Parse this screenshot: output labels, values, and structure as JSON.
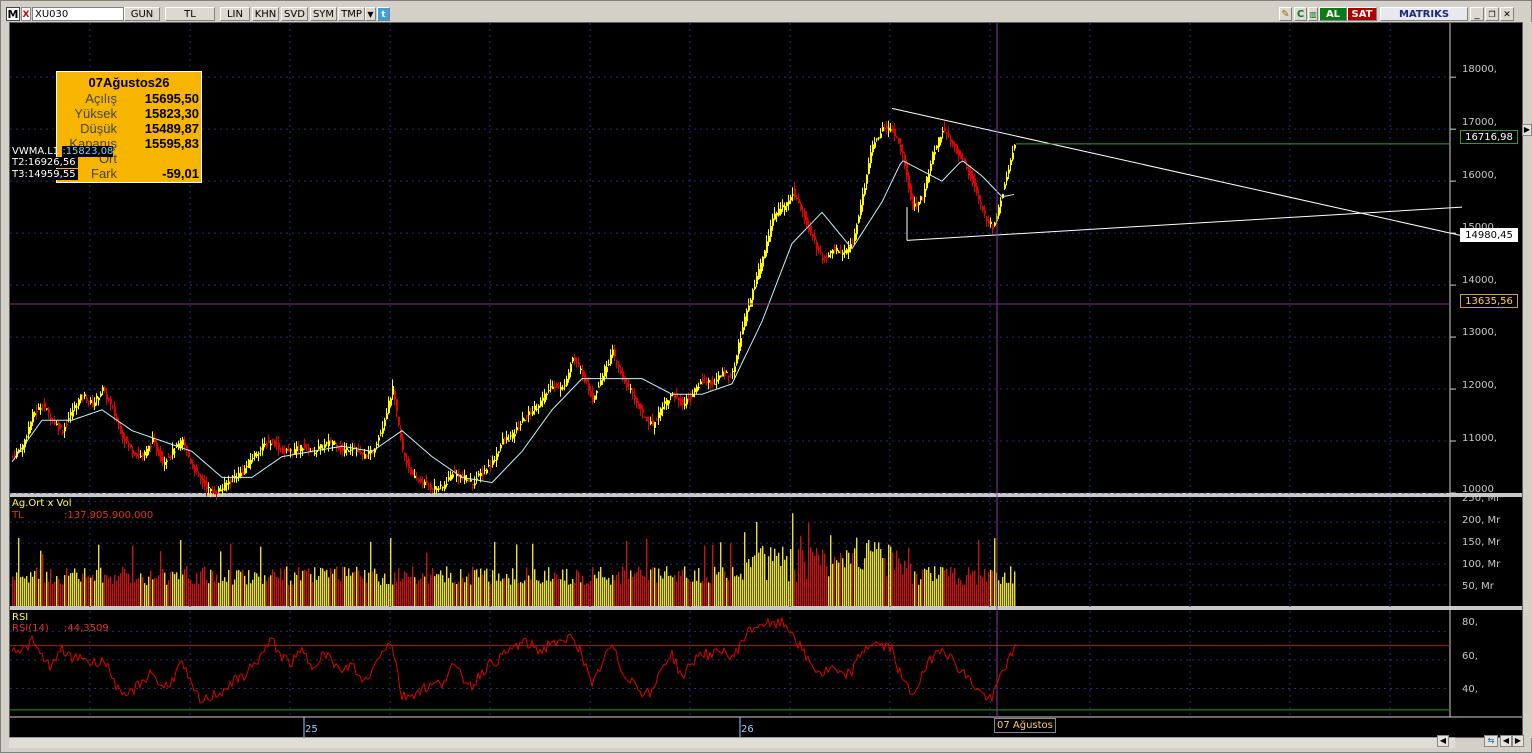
{
  "toolbar": {
    "logo": "M",
    "close": "X",
    "symbol": "XU030",
    "period_buttons": [
      "GUN",
      "TL",
      "LIN",
      "KHN",
      "SVD",
      "SYM",
      "TMP"
    ],
    "buy_label": "AL",
    "sell_label": "SAT",
    "brand": "MATRIKS"
  },
  "colors": {
    "background": "#000000",
    "up_candle": "#ffff00",
    "down_candle": "#e00000",
    "vwma_line": "#c8f0ff",
    "rsi_line": "#e00000",
    "grid": "#203080",
    "trend_line": "#ffffff",
    "info_box": "#f7b500",
    "crosshair": "#8040a0"
  },
  "info_box": {
    "date": "07Ağustos26",
    "rows": [
      {
        "label": "Açılış",
        "value": "15695,50"
      },
      {
        "label": "Yüksek",
        "value": "15823,30"
      },
      {
        "label": "Düşük",
        "value": "15489,87"
      },
      {
        "label": "Kapanış",
        "value": "15595,83"
      },
      {
        "label": "Ort",
        "value": ""
      },
      {
        "label": "Fark",
        "value": "-59,01"
      }
    ]
  },
  "indicators": {
    "vwma_label": "VWMA.L1",
    "vwma_value": ":15823,08",
    "t2": "T2:16926,56",
    "t3": "T3:14959,55"
  },
  "price_axis": {
    "ticks": [
      "18000,",
      "17000,",
      "16000,",
      "15000,",
      "14000,",
      "13000,",
      "12000,",
      "11000,",
      "10000"
    ],
    "box_top": "16716,98",
    "box_mid": "14980,45",
    "box_low": "13635,56"
  },
  "volume_pane": {
    "title": "Ag.Ort x Vol",
    "series_label": "TL",
    "series_value": ":137.905.900.000",
    "ticks": [
      "250, Mr",
      "200, Mr",
      "150, Mr",
      "100, Mr",
      "50, Mr"
    ]
  },
  "rsi_pane": {
    "title": "RSI",
    "series_label": "RSI(14)",
    "series_value": ":44,3509",
    "ticks": [
      "80,",
      "60,",
      "40,"
    ]
  },
  "time_axis": {
    "labels": [
      "25",
      "26"
    ],
    "cursor_label": "07 Ağustos"
  },
  "chart_data": {
    "type": "candlestick",
    "title": "XU030",
    "ylim": [
      10000,
      18500
    ],
    "x_ticks": [
      "25",
      "26"
    ],
    "price_path": [
      [
        0,
        10700
      ],
      [
        10,
        10900
      ],
      [
        20,
        11500
      ],
      [
        30,
        11700
      ],
      [
        40,
        11400
      ],
      [
        50,
        11200
      ],
      [
        60,
        11600
      ],
      [
        70,
        11900
      ],
      [
        80,
        11700
      ],
      [
        90,
        12000
      ],
      [
        100,
        11600
      ],
      [
        110,
        11100
      ],
      [
        120,
        10800
      ],
      [
        130,
        10700
      ],
      [
        140,
        11000
      ],
      [
        150,
        10600
      ],
      [
        160,
        10800
      ],
      [
        170,
        11000
      ],
      [
        180,
        10500
      ],
      [
        190,
        10200
      ],
      [
        200,
        10000
      ],
      [
        210,
        10100
      ],
      [
        220,
        10300
      ],
      [
        230,
        10400
      ],
      [
        240,
        10700
      ],
      [
        250,
        10900
      ],
      [
        260,
        11000
      ],
      [
        270,
        10800
      ],
      [
        280,
        10800
      ],
      [
        290,
        10900
      ],
      [
        300,
        10800
      ],
      [
        310,
        10900
      ],
      [
        320,
        11000
      ],
      [
        330,
        10800
      ],
      [
        340,
        10900
      ],
      [
        350,
        10700
      ],
      [
        360,
        10800
      ],
      [
        370,
        11300
      ],
      [
        380,
        12000
      ],
      [
        390,
        10800
      ],
      [
        400,
        10300
      ],
      [
        410,
        10200
      ],
      [
        420,
        10100
      ],
      [
        430,
        10100
      ],
      [
        440,
        10400
      ],
      [
        450,
        10300
      ],
      [
        460,
        10200
      ],
      [
        470,
        10400
      ],
      [
        480,
        10600
      ],
      [
        490,
        11000
      ],
      [
        500,
        11100
      ],
      [
        510,
        11400
      ],
      [
        520,
        11600
      ],
      [
        530,
        11800
      ],
      [
        540,
        12100
      ],
      [
        550,
        12000
      ],
      [
        560,
        12600
      ],
      [
        570,
        12300
      ],
      [
        580,
        11800
      ],
      [
        590,
        12300
      ],
      [
        600,
        12700
      ],
      [
        610,
        12200
      ],
      [
        620,
        11900
      ],
      [
        630,
        11500
      ],
      [
        640,
        11300
      ],
      [
        650,
        11700
      ],
      [
        660,
        11900
      ],
      [
        670,
        11700
      ],
      [
        680,
        11900
      ],
      [
        690,
        12200
      ],
      [
        700,
        12100
      ],
      [
        710,
        12300
      ],
      [
        720,
        12300
      ],
      [
        730,
        13200
      ],
      [
        740,
        13900
      ],
      [
        750,
        14500
      ],
      [
        760,
        15300
      ],
      [
        770,
        15500
      ],
      [
        780,
        15800
      ],
      [
        790,
        15400
      ],
      [
        800,
        14900
      ],
      [
        810,
        14500
      ],
      [
        820,
        14700
      ],
      [
        830,
        14600
      ],
      [
        840,
        14800
      ],
      [
        850,
        15700
      ],
      [
        860,
        16700
      ],
      [
        870,
        17000
      ],
      [
        880,
        17000
      ],
      [
        890,
        16500
      ],
      [
        900,
        15500
      ],
      [
        910,
        15700
      ],
      [
        920,
        16500
      ],
      [
        930,
        17000
      ],
      [
        940,
        16700
      ],
      [
        950,
        16400
      ],
      [
        960,
        16000
      ],
      [
        970,
        15400
      ],
      [
        980,
        15100
      ],
      [
        990,
        15800
      ],
      [
        1000,
        16600
      ],
      [
        1004,
        16700
      ]
    ],
    "vwma_path": [
      [
        0,
        10600
      ],
      [
        30,
        11400
      ],
      [
        60,
        11400
      ],
      [
        90,
        11600
      ],
      [
        120,
        11200
      ],
      [
        150,
        11000
      ],
      [
        180,
        10800
      ],
      [
        210,
        10300
      ],
      [
        240,
        10300
      ],
      [
        270,
        10700
      ],
      [
        300,
        10800
      ],
      [
        330,
        10900
      ],
      [
        360,
        10800
      ],
      [
        390,
        11200
      ],
      [
        420,
        10700
      ],
      [
        450,
        10300
      ],
      [
        480,
        10200
      ],
      [
        510,
        10800
      ],
      [
        540,
        11600
      ],
      [
        570,
        12200
      ],
      [
        600,
        12200
      ],
      [
        630,
        12200
      ],
      [
        660,
        11900
      ],
      [
        690,
        11900
      ],
      [
        720,
        12100
      ],
      [
        750,
        13300
      ],
      [
        780,
        14800
      ],
      [
        810,
        15400
      ],
      [
        840,
        14700
      ],
      [
        870,
        15600
      ],
      [
        890,
        16400
      ],
      [
        910,
        16200
      ],
      [
        930,
        16000
      ],
      [
        950,
        16400
      ],
      [
        970,
        16100
      ],
      [
        990,
        15700
      ],
      [
        1004,
        15750
      ]
    ],
    "trend_upper": [
      [
        880,
        17400
      ],
      [
        1450,
        14950
      ]
    ],
    "trend_lower": [
      [
        895,
        14860
      ],
      [
        1450,
        15500
      ]
    ],
    "horizontal_levels": [
      16716.98,
      13635.56
    ],
    "volume_bn": {
      "ticks": [
        250,
        200,
        150,
        100,
        50
      ],
      "typical": 80,
      "max": 240
    },
    "rsi": {
      "ticks": [
        80,
        60,
        40
      ],
      "upper_band": 70,
      "lower_band": 30,
      "path": [
        [
          0,
          70
        ],
        [
          10,
          66
        ],
        [
          20,
          73
        ],
        [
          30,
          62
        ],
        [
          40,
          55
        ],
        [
          50,
          68
        ],
        [
          60,
          60
        ],
        [
          70,
          63
        ],
        [
          80,
          57
        ],
        [
          90,
          61
        ],
        [
          100,
          50
        ],
        [
          110,
          32
        ],
        [
          120,
          38
        ],
        [
          130,
          45
        ],
        [
          140,
          52
        ],
        [
          150,
          40
        ],
        [
          160,
          46
        ],
        [
          170,
          58
        ],
        [
          180,
          40
        ],
        [
          190,
          30
        ],
        [
          200,
          35
        ],
        [
          210,
          38
        ],
        [
          220,
          44
        ],
        [
          230,
          48
        ],
        [
          240,
          55
        ],
        [
          250,
          64
        ],
        [
          260,
          74
        ],
        [
          270,
          62
        ],
        [
          280,
          58
        ],
        [
          290,
          66
        ],
        [
          300,
          56
        ],
        [
          310,
          64
        ],
        [
          320,
          60
        ],
        [
          330,
          50
        ],
        [
          340,
          58
        ],
        [
          350,
          44
        ],
        [
          360,
          52
        ],
        [
          370,
          68
        ],
        [
          380,
          72
        ],
        [
          390,
          34
        ],
        [
          400,
          36
        ],
        [
          410,
          40
        ],
        [
          420,
          42
        ],
        [
          430,
          44
        ],
        [
          440,
          56
        ],
        [
          450,
          48
        ],
        [
          460,
          42
        ],
        [
          470,
          52
        ],
        [
          480,
          58
        ],
        [
          490,
          62
        ],
        [
          500,
          68
        ],
        [
          510,
          72
        ],
        [
          520,
          70
        ],
        [
          530,
          66
        ],
        [
          540,
          74
        ],
        [
          550,
          70
        ],
        [
          560,
          78
        ],
        [
          570,
          64
        ],
        [
          580,
          40
        ],
        [
          590,
          58
        ],
        [
          600,
          70
        ],
        [
          610,
          52
        ],
        [
          620,
          46
        ],
        [
          630,
          38
        ],
        [
          640,
          36
        ],
        [
          650,
          56
        ],
        [
          660,
          64
        ],
        [
          670,
          48
        ],
        [
          680,
          58
        ],
        [
          690,
          66
        ],
        [
          700,
          62
        ],
        [
          710,
          68
        ],
        [
          720,
          60
        ],
        [
          730,
          74
        ],
        [
          740,
          82
        ],
        [
          750,
          86
        ],
        [
          760,
          84
        ],
        [
          770,
          86
        ],
        [
          780,
          80
        ],
        [
          790,
          66
        ],
        [
          800,
          56
        ],
        [
          810,
          50
        ],
        [
          820,
          54
        ],
        [
          830,
          48
        ],
        [
          840,
          52
        ],
        [
          850,
          66
        ],
        [
          860,
          72
        ],
        [
          870,
          70
        ],
        [
          880,
          68
        ],
        [
          890,
          46
        ],
        [
          900,
          36
        ],
        [
          910,
          48
        ],
        [
          920,
          62
        ],
        [
          930,
          70
        ],
        [
          940,
          60
        ],
        [
          950,
          52
        ],
        [
          960,
          44
        ],
        [
          970,
          36
        ],
        [
          980,
          32
        ],
        [
          990,
          52
        ],
        [
          1004,
          68
        ]
      ]
    }
  }
}
